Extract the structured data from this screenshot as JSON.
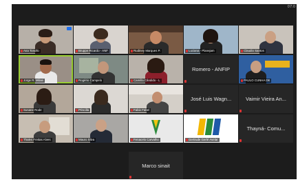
{
  "app": {
    "clock": "07:0"
  },
  "participants": [
    {
      "label": "Ana Tonollo",
      "video": true
    },
    {
      "label": "Bruppe Ricardo - ANF",
      "video": true
    },
    {
      "label": "Rudiney Marques P.",
      "video": true
    },
    {
      "label": "Luciana - Planejam",
      "video": true
    },
    {
      "label": "Claudio Santos",
      "video": true
    },
    {
      "label": "Jorge R. Milani",
      "video": true,
      "active": true
    },
    {
      "label": "Rogério Campelo",
      "video": true
    },
    {
      "label": "Camilla Cândido - L",
      "video": true
    },
    {
      "label": "Romero - ANFIP",
      "video": false
    },
    {
      "label": "PAULO CUNHA DE",
      "video": true
    },
    {
      "label": "Susane Rode",
      "video": true
    },
    {
      "label": "Priscilla",
      "video": true
    },
    {
      "label": "Fabio Fabel",
      "video": true
    },
    {
      "label": "José Luis Wagn...",
      "video": false
    },
    {
      "label": "Vaimir Vieira An...",
      "video": false
    },
    {
      "label": "Thales Freitas Alves",
      "video": true
    },
    {
      "label": "Mauro Silva",
      "video": true
    },
    {
      "label": "Fenacelo Carvalho",
      "video": true
    },
    {
      "label": "Gertrude Gerlé Avelar",
      "video": true
    },
    {
      "label": "Thayná- Comu...",
      "video": false
    },
    {
      "label": "Marco sinait",
      "video": false
    }
  ]
}
